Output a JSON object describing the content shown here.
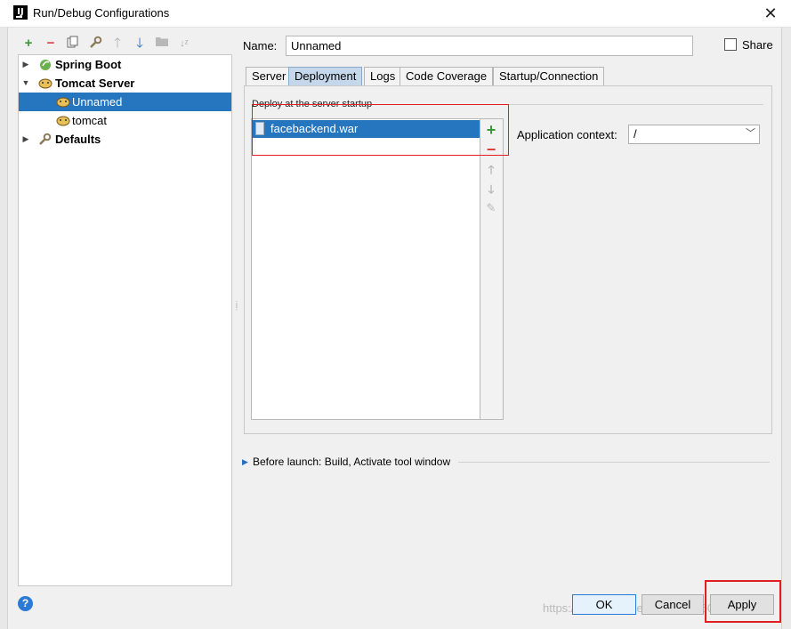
{
  "window": {
    "title": "Run/Debug Configurations",
    "icon": "intellij-app-icon",
    "close_label": "✕"
  },
  "left_toolbar": {
    "icons": [
      "add-icon",
      "remove-icon",
      "copy-icon",
      "wrench-icon",
      "move-up-icon",
      "move-down-icon",
      "folder-icon",
      "sort-icon"
    ]
  },
  "tree": {
    "items": [
      {
        "label": "Spring Boot",
        "bold": true,
        "expanded": false
      },
      {
        "label": "Tomcat Server",
        "bold": true,
        "expanded": true
      },
      {
        "label": "Unnamed",
        "selected": true
      },
      {
        "label": "tomcat"
      },
      {
        "label": "Defaults",
        "bold": true,
        "expanded": false
      }
    ]
  },
  "name_field": {
    "label": "Name:",
    "value": "Unnamed"
  },
  "share": {
    "label": "Share",
    "checked": false
  },
  "tabs": [
    {
      "label": "Server"
    },
    {
      "label": "Deployment",
      "active": true
    },
    {
      "label": "Logs"
    },
    {
      "label": "Code Coverage"
    },
    {
      "label": "Startup/Connection"
    }
  ],
  "deployment": {
    "section_label": "Deploy at the server startup",
    "artifacts": [
      "facebackend.war"
    ],
    "context_label": "Application context:",
    "context_value": "/"
  },
  "before_launch": {
    "text": "Before launch: Build, Activate tool window"
  },
  "buttons": {
    "help": "?",
    "ok": "OK",
    "cancel": "Cancel",
    "apply": "Apply"
  },
  "watermark": "https://blog.csdn.net/weixin_4160",
  "colors": {
    "selection": "#2675bf",
    "highlight_box": "#e02020",
    "add_green": "#3a9a3a",
    "remove_red": "#d94040"
  }
}
